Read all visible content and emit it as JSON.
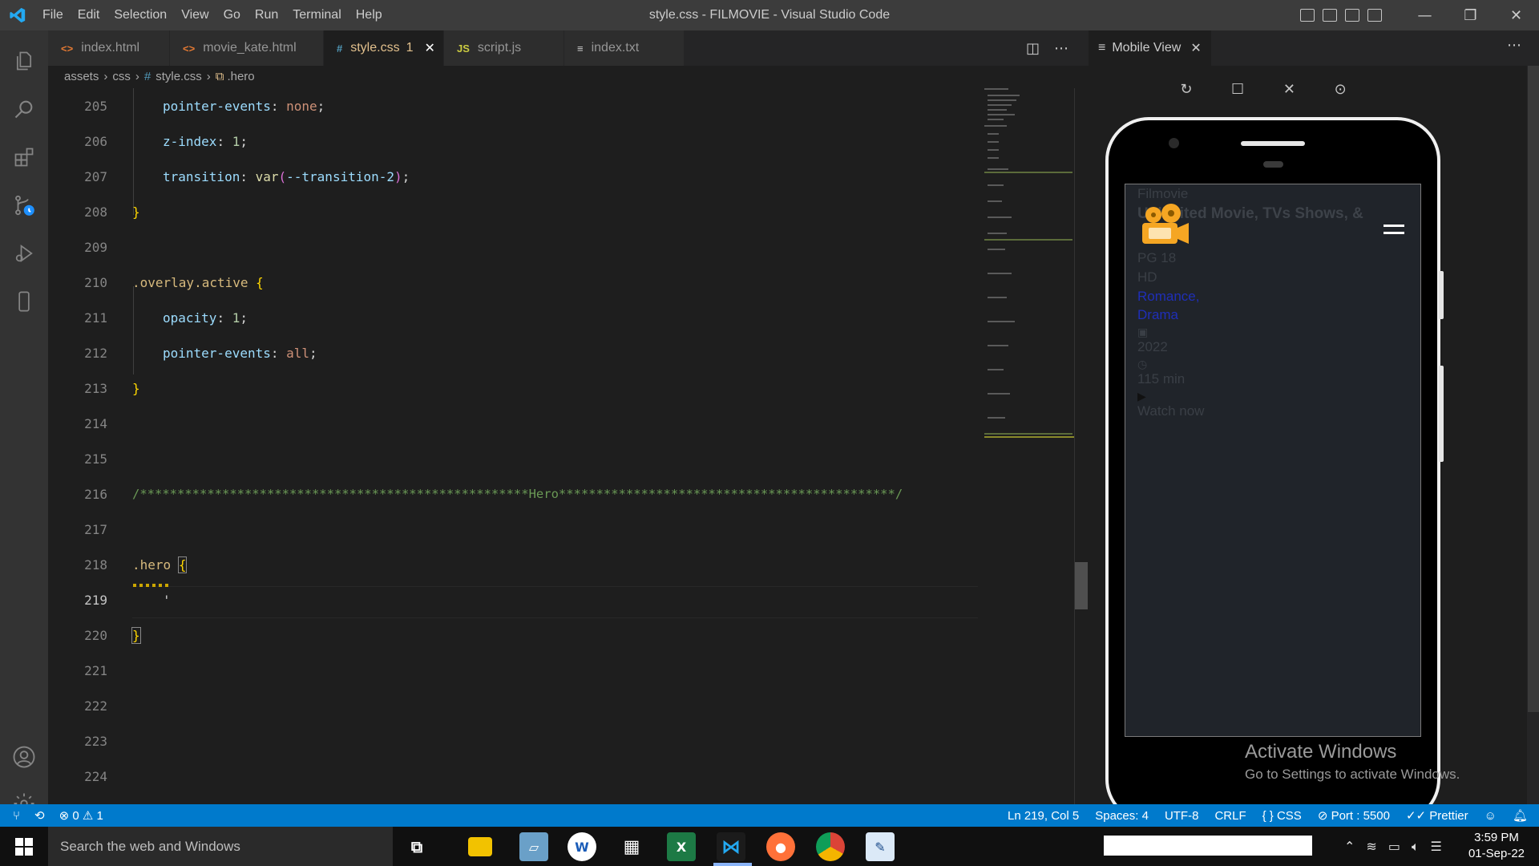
{
  "window": {
    "title": "style.css - FILMOVIE - Visual Studio Code",
    "menu": [
      "File",
      "Edit",
      "Selection",
      "View",
      "Go",
      "Run",
      "Terminal",
      "Help"
    ]
  },
  "tabs": [
    {
      "icon": "<>",
      "label": "index.html",
      "active": false
    },
    {
      "icon": "<>",
      "label": "movie_kate.html",
      "active": false
    },
    {
      "icon": "#",
      "label": "style.css",
      "badge": "1",
      "active": true
    },
    {
      "icon": "JS",
      "label": "script.js",
      "active": false
    },
    {
      "icon": "≡",
      "label": "index.txt",
      "active": false
    }
  ],
  "breadcrumb": {
    "p1": "assets",
    "p2": "css",
    "p3": "style.css",
    "p4": ".hero"
  },
  "code_lines": [
    {
      "num": "205",
      "text": "pointer-events: none;"
    },
    {
      "num": "206",
      "text": "z-index: 1;"
    },
    {
      "num": "207",
      "text": "transition: var(--transition-2);"
    },
    {
      "num": "208",
      "text": "}"
    },
    {
      "num": "209",
      "text": ""
    },
    {
      "num": "210",
      "text": ".overlay.active {"
    },
    {
      "num": "211",
      "text": "opacity: 1;"
    },
    {
      "num": "212",
      "text": "pointer-events: all;"
    },
    {
      "num": "213",
      "text": "}"
    },
    {
      "num": "214",
      "text": ""
    },
    {
      "num": "215",
      "text": ""
    },
    {
      "num": "216",
      "text": "/****************************************************Hero*********************************************/"
    },
    {
      "num": "217",
      "text": ""
    },
    {
      "num": "218",
      "text": ".hero {"
    },
    {
      "num": "219",
      "text": "'"
    },
    {
      "num": "220",
      "text": "}"
    },
    {
      "num": "221",
      "text": ""
    },
    {
      "num": "222",
      "text": ""
    },
    {
      "num": "223",
      "text": ""
    },
    {
      "num": "224",
      "text": ""
    }
  ],
  "right_panel": {
    "tab_label": "Mobile View",
    "screen": {
      "brand": "Filmovie",
      "headline": "Unlimited Movie, TVs Shows, &",
      "rating": "PG 18",
      "quality": "HD",
      "genre1": "Romance,",
      "genre2": "Drama",
      "year": "2022",
      "duration": "115 min",
      "watch": "Watch now"
    },
    "activate_title": "Activate Windows",
    "activate_sub": "Go to Settings to activate Windows."
  },
  "status": {
    "errors": "0",
    "warnings": "1",
    "position": "Ln 219, Col 5",
    "spaces": "Spaces: 4",
    "encoding": "UTF-8",
    "eol": "CRLF",
    "language": "CSS",
    "port": "Port : 5500",
    "formatter": "Prettier"
  },
  "taskbar": {
    "search_placeholder": "Search the web and Windows",
    "time": "3:59 PM",
    "date": "01-Sep-22"
  },
  "colors": {
    "accent": "#007acc",
    "tab_active_text": "#e2c08d"
  }
}
